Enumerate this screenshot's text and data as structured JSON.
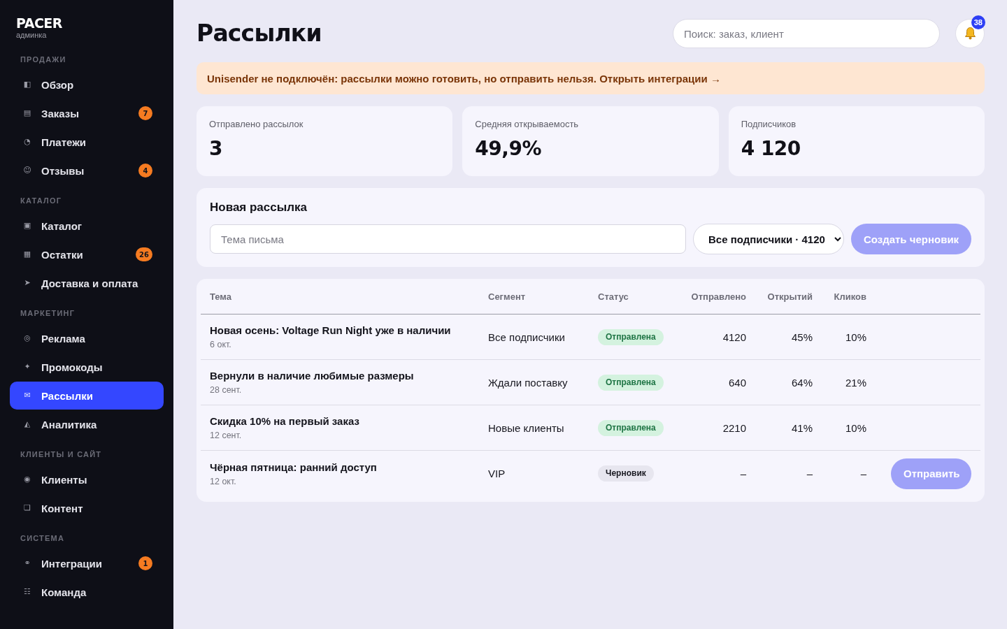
{
  "sidebar": {
    "brand": "PACER",
    "subtitle": "админка",
    "sections": [
      {
        "title": "ПРОДАЖИ",
        "items": [
          {
            "icon": "◧",
            "label": "Обзор",
            "selected": false
          },
          {
            "icon": "▤",
            "label": "Заказы",
            "badge": "7",
            "selected": false
          },
          {
            "icon": "◔",
            "label": "Платежи",
            "selected": false
          },
          {
            "icon": "☺",
            "label": "Отзывы",
            "badge": "4",
            "selected": false
          }
        ]
      },
      {
        "title": "КАТАЛОГ",
        "items": [
          {
            "icon": "▣",
            "label": "Каталог",
            "selected": false
          },
          {
            "icon": "▦",
            "label": "Остатки",
            "badge": "26",
            "selected": false
          },
          {
            "icon": "➤",
            "label": "Доставка и оплата",
            "selected": false
          }
        ]
      },
      {
        "title": "МАРКЕТИНГ",
        "items": [
          {
            "icon": "◎",
            "label": "Реклама",
            "selected": false
          },
          {
            "icon": "✦",
            "label": "Промокоды",
            "selected": false
          },
          {
            "icon": "✉",
            "label": "Рассылки",
            "selected": true
          },
          {
            "icon": "◭",
            "label": "Аналитика",
            "selected": false
          }
        ]
      },
      {
        "title": "КЛИЕНТЫ И САЙТ",
        "items": [
          {
            "icon": "◉",
            "label": "Клиенты",
            "selected": false
          },
          {
            "icon": "❏",
            "label": "Контент",
            "selected": false
          }
        ]
      },
      {
        "title": "СИСТЕМА",
        "items": [
          {
            "icon": "⚭",
            "label": "Интеграции",
            "badge": "1",
            "selected": false
          },
          {
            "icon": "☷",
            "label": "Команда",
            "selected": false
          }
        ]
      }
    ]
  },
  "header": {
    "title": "Рассылки",
    "search": {
      "placeholder": "Поиск: заказ, клиент"
    },
    "notifications": {
      "badge": "38"
    }
  },
  "banner": {
    "text": "Unisender не подключён: рассылки можно готовить, но отправить нельзя.",
    "link": "Открыть интеграции →"
  },
  "stats": [
    {
      "label": "Отправлено рассылок",
      "value": "3"
    },
    {
      "label": "Средняя открываемость",
      "value": "49,9%"
    },
    {
      "label": "Подписчиков",
      "value": "4 120"
    }
  ],
  "new_mailing": {
    "title": "Новая рассылка",
    "subject": {
      "placeholder": "Тема письма"
    },
    "segment": {
      "value": "Все подписчики · 4120"
    },
    "create_button": {
      "label": "Создать черновик",
      "disabled": true
    }
  },
  "table": {
    "columns": [
      "Тема",
      "Сегмент",
      "Статус",
      "Отправлено",
      "Открытий",
      "Кликов"
    ],
    "rows": [
      {
        "subject": "Новая осень: Voltage Run Night уже в наличии",
        "date": "6 окт.",
        "segment": "Все подписчики",
        "status": {
          "label": "Отправлена",
          "kind": "sent"
        },
        "sent": "4120",
        "opens": "45%",
        "clicks": "10%"
      },
      {
        "subject": "Вернули в наличие любимые размеры",
        "date": "28 сент.",
        "segment": "Ждали поставку",
        "status": {
          "label": "Отправлена",
          "kind": "sent"
        },
        "sent": "640",
        "opens": "64%",
        "clicks": "21%"
      },
      {
        "subject": "Скидка 10% на первый заказ",
        "date": "12 сент.",
        "segment": "Новые клиенты",
        "status": {
          "label": "Отправлена",
          "kind": "sent"
        },
        "sent": "2210",
        "opens": "41%",
        "clicks": "10%"
      },
      {
        "subject": "Чёрная пятница: ранний доступ",
        "date": "12 окт.",
        "segment": "VIP",
        "status": {
          "label": "Черновик",
          "kind": "draft"
        },
        "sent": "–",
        "opens": "–",
        "clicks": "–",
        "action": {
          "label": "Отправить",
          "disabled": true
        }
      }
    ]
  }
}
